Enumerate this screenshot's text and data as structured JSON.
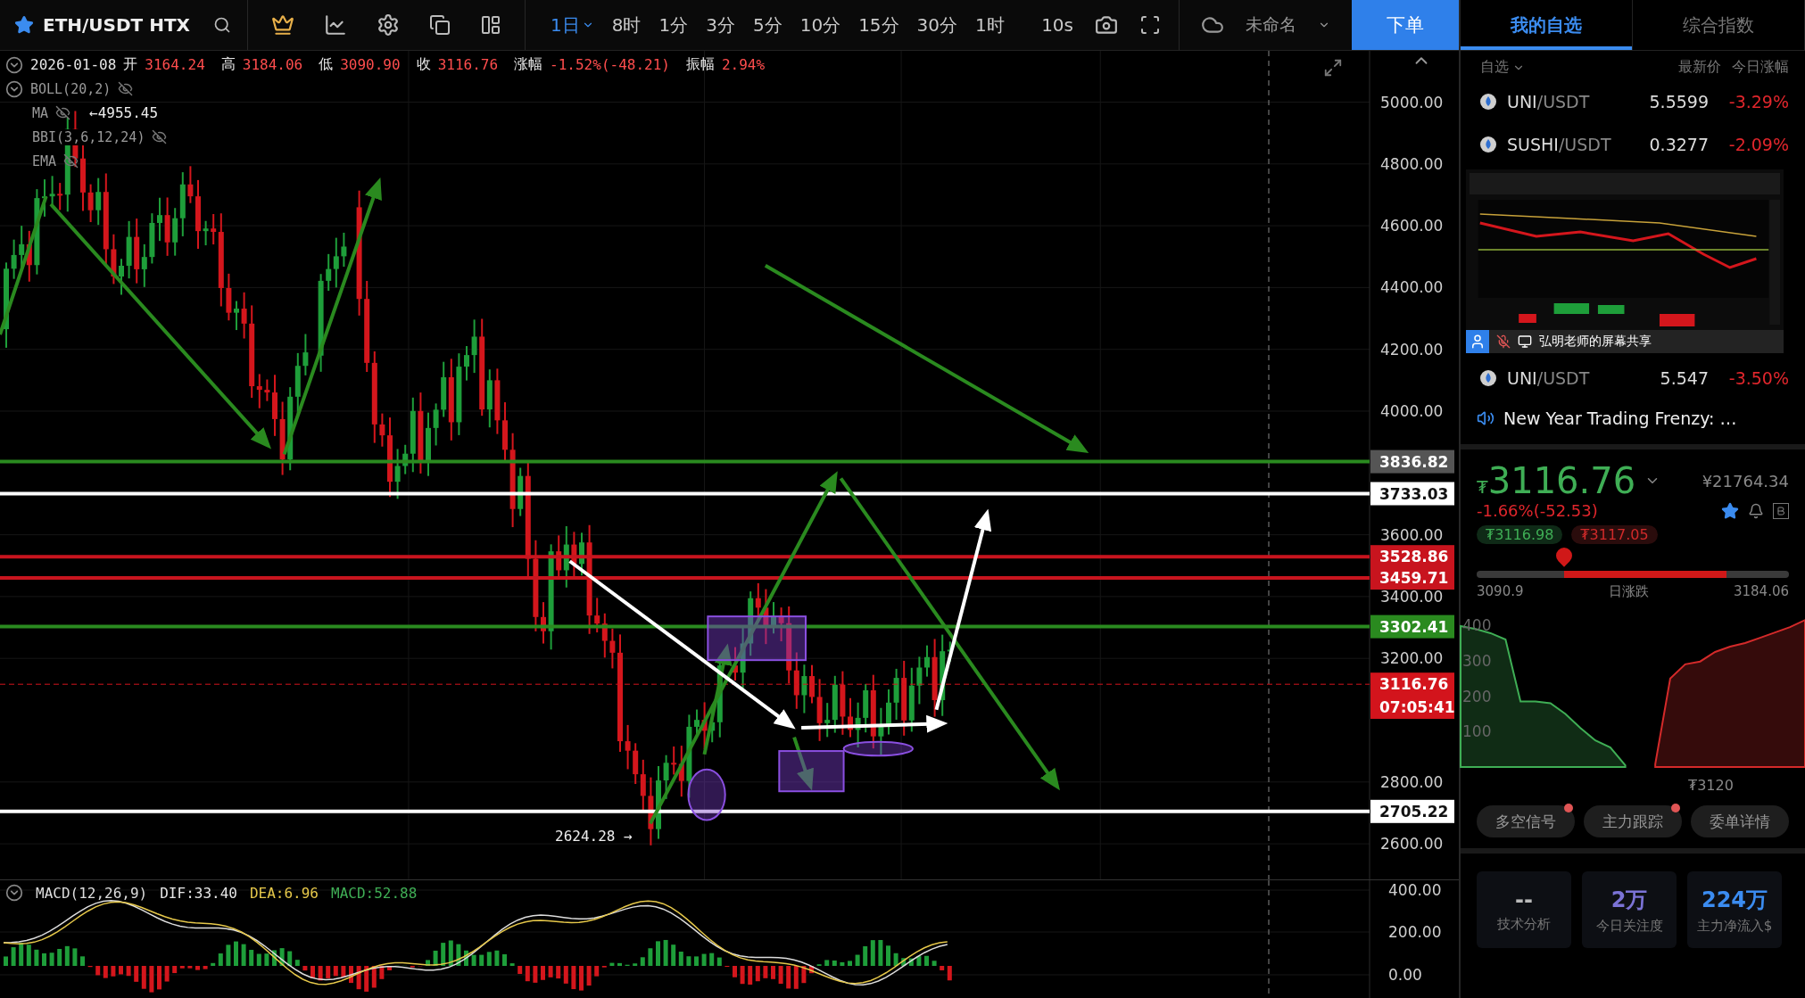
{
  "toolbar": {
    "symbol": "ETH/USDT HTX",
    "intervals": [
      {
        "label": "1日",
        "selected": true
      },
      {
        "label": "8时",
        "selected": false
      },
      {
        "label": "1分",
        "selected": false
      },
      {
        "label": "3分",
        "selected": false
      },
      {
        "label": "5分",
        "selected": false
      },
      {
        "label": "10分",
        "selected": false
      },
      {
        "label": "15分",
        "selected": false
      },
      {
        "label": "30分",
        "selected": false
      },
      {
        "label": "1时",
        "selected": false
      }
    ],
    "refresh": "10s",
    "layout_name": "未命名",
    "order_button": "下单"
  },
  "chart": {
    "info": [
      {
        "label": "2026-01-08"
      },
      {
        "label": "开",
        "value": "3164.24"
      },
      {
        "label": "高",
        "value": "3184.06"
      },
      {
        "label": "低",
        "value": "3090.90"
      },
      {
        "label": "收",
        "value": "3116.76"
      },
      {
        "label": "涨幅",
        "value": "-1.52%(-48.21)"
      },
      {
        "label": "振幅",
        "value": "2.94%"
      }
    ],
    "indicators": [
      {
        "label": "BOLL(20,2)",
        "hidden": true
      },
      {
        "label": "MA",
        "hidden": true
      },
      {
        "label": "BBI(3,6,12,24)",
        "hidden": true
      },
      {
        "label": "EMA",
        "hidden": true
      }
    ],
    "high_marker": "←4955.45",
    "low_marker": "2624.28 →",
    "axis": [
      "5000.00",
      "4800.00",
      "4600.00",
      "4400.00",
      "4200.00",
      "4000.00",
      "3600.00",
      "3400.00",
      "3200.00",
      "2800.00",
      "2600.00"
    ],
    "price_lines": [
      {
        "label": "3836.82",
        "color": "#555555",
        "kind": "crosshair"
      },
      {
        "label": "3733.03",
        "color": "#ffffff",
        "kind": "level"
      },
      {
        "label": "3528.86",
        "color": "#c8141e",
        "kind": "level"
      },
      {
        "label": "3459.71",
        "color": "#c8141e",
        "kind": "level"
      },
      {
        "label": "3302.41",
        "color": "#2a8a1f",
        "kind": "level"
      },
      {
        "label": "3116.76",
        "color": "#d3141c",
        "kind": "current"
      },
      {
        "label": "2705.22",
        "color": "#ffffff",
        "kind": "level"
      }
    ],
    "countdown": "07:05:41"
  },
  "macd": {
    "title": "MACD(12,26,9)",
    "values": [
      {
        "text": "DIF:33.40",
        "color": "#e6e6e6"
      },
      {
        "text": "DEA:6.96",
        "color": "#e6c84a"
      },
      {
        "text": "MACD:52.88",
        "color": "#3fae55"
      }
    ],
    "axis": [
      "400.00",
      "200.00",
      "0.00"
    ]
  },
  "watchlist": {
    "tabs": [
      {
        "label": "我的自选",
        "selected": true
      },
      {
        "label": "综合指数",
        "selected": false
      }
    ],
    "group": "自选",
    "columns": [
      "最新价",
      "今日涨幅"
    ],
    "rows": [
      {
        "base": "UNI",
        "quote": "/USDT",
        "price": "5.5599",
        "change": "-3.29%"
      },
      {
        "base": "SUSHI",
        "quote": "/USDT",
        "price": "0.3277",
        "change": "-2.09%"
      }
    ],
    "share_caption": "弘明老师的屏幕共享",
    "rows_after": [
      {
        "base": "UNI",
        "quote": "/USDT",
        "price": "5.547",
        "change": "-3.50%"
      }
    ],
    "news": "New Year Trading Frenzy: …"
  },
  "quote": {
    "currency": "₮",
    "price": "3116.76",
    "cny": "¥21764.34",
    "change": "-1.66%(-52.53)",
    "bid": "₮3116.98",
    "ask": "₮3117.05",
    "range": {
      "low": "3090.9",
      "label": "日涨跌",
      "high": "3184.06",
      "level": 0.28
    }
  },
  "depth": {
    "mid_price": "₮3120",
    "axis": [
      "400",
      "300",
      "200",
      "100"
    ]
  },
  "tools": [
    {
      "label": "多空信号",
      "dot": true
    },
    {
      "label": "主力跟踪",
      "dot": true
    },
    {
      "label": "委单详情",
      "dot": false
    }
  ],
  "stats": [
    {
      "value": "--",
      "label": "技术分析",
      "color": "#bbbbbb"
    },
    {
      "value": "2万",
      "label": "今日关注度",
      "color": "#7b73d6"
    },
    {
      "value": "224万",
      "label": "主力净流入$",
      "color": "#3b8cf0"
    }
  ]
}
